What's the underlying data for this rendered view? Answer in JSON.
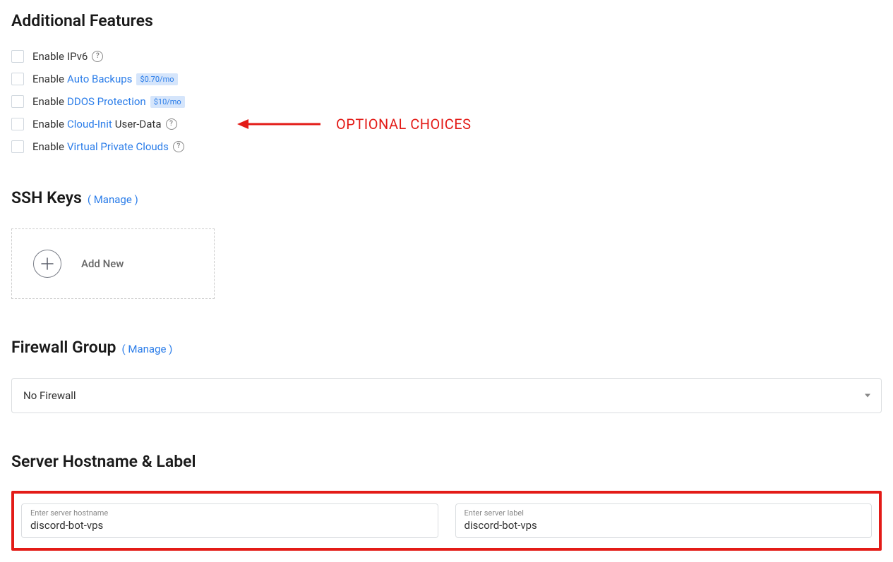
{
  "sections": {
    "additional_features": {
      "heading": "Additional Features",
      "items": [
        {
          "prefix": "Enable",
          "link": "",
          "suffix": "IPv6",
          "price": "",
          "help": true
        },
        {
          "prefix": "Enable",
          "link": "Auto Backups",
          "suffix": "",
          "price": "$0.70/mo",
          "help": false
        },
        {
          "prefix": "Enable",
          "link": "DDOS Protection",
          "suffix": "",
          "price": "$10/mo",
          "help": false
        },
        {
          "prefix": "Enable",
          "link": "Cloud-Init",
          "suffix": "User-Data",
          "price": "",
          "help": true
        },
        {
          "prefix": "Enable",
          "link": "Virtual Private Clouds",
          "suffix": "",
          "price": "",
          "help": true
        }
      ]
    },
    "ssh_keys": {
      "heading": "SSH Keys",
      "manage": "( Manage )",
      "add_new": "Add New"
    },
    "firewall": {
      "heading": "Firewall Group",
      "manage": "( Manage )",
      "selected": "No Firewall"
    },
    "hostname": {
      "heading": "Server Hostname & Label",
      "hostname_label": "Enter server hostname",
      "hostname_value": "discord-bot-vps",
      "label_label": "Enter server label",
      "label_value": "discord-bot-vps"
    }
  },
  "annotation": {
    "text": "OPTIONAL CHOICES"
  }
}
